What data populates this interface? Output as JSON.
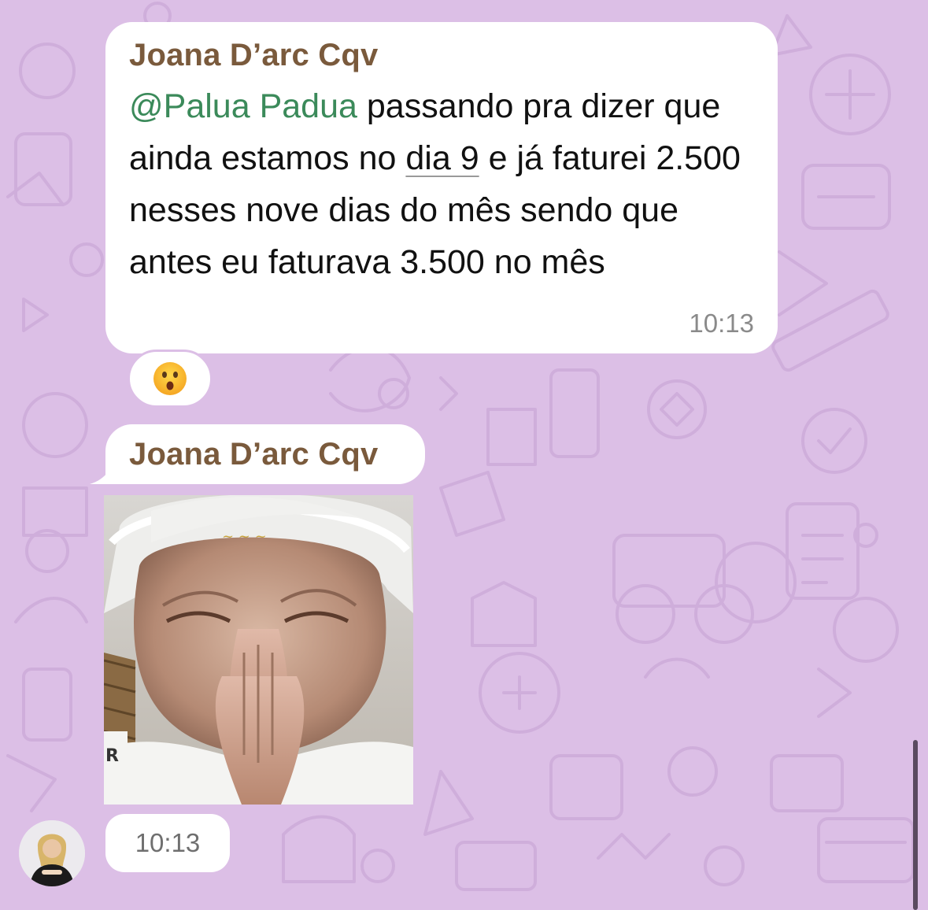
{
  "colors": {
    "wallpaper": "#dcbfe6",
    "bubble": "#ffffff",
    "sender_name": "#7a5a3c",
    "mention": "#3b8a5a",
    "timestamp": "#8a8a8a"
  },
  "messages": [
    {
      "sender": "Joana D’arc Cqv",
      "mention": "@Palua Padua",
      "text_part1": " passando pra dizer que ainda estamos no ",
      "link_text": "dia 9",
      "text_part2": " e já faturei 2.500 nesses nove dias do mês sendo que antes eu faturava 3.500 no mês",
      "time": "10:13",
      "reaction": "hushed-face-emoji"
    },
    {
      "sender": "Joana D’arc Cqv",
      "media": "photo-gif",
      "time": "10:13",
      "avatar": "sender-avatar"
    }
  ]
}
